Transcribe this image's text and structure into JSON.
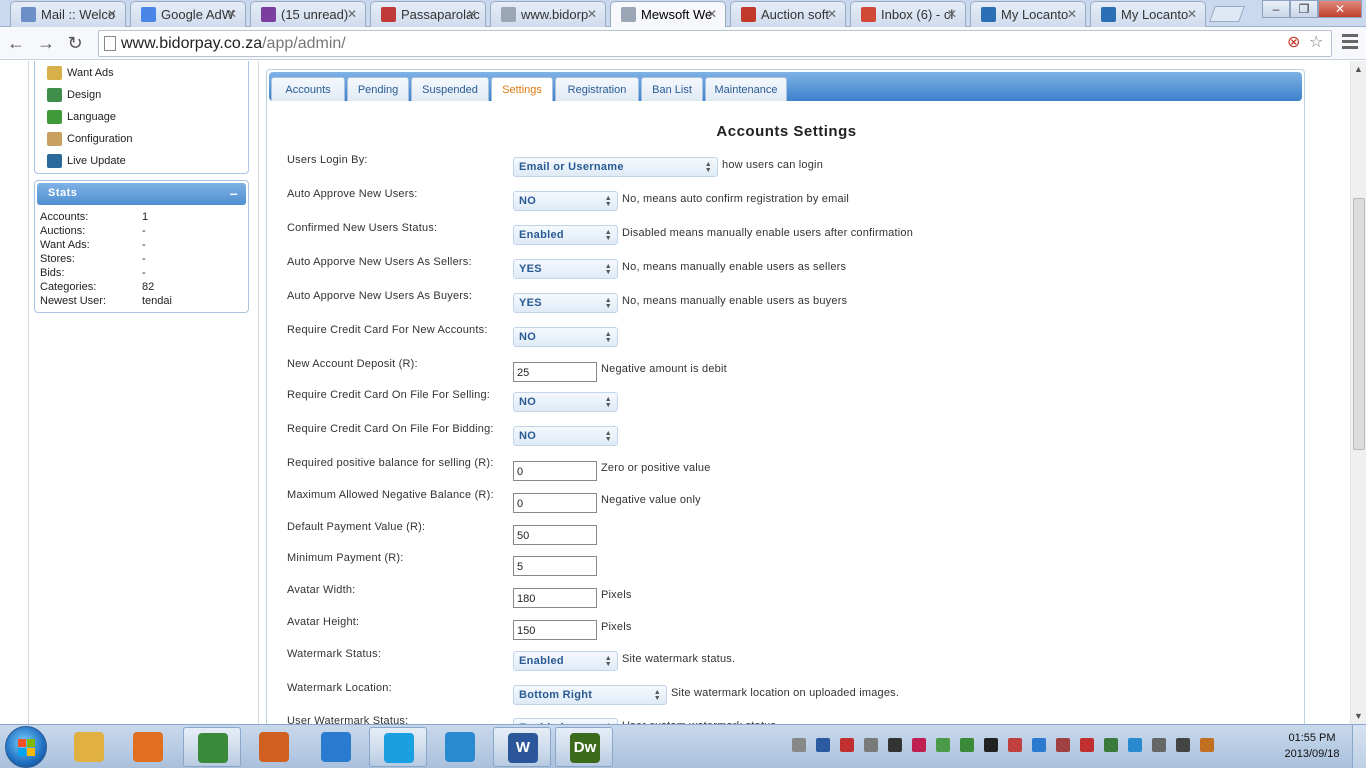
{
  "browser": {
    "tabs": [
      {
        "title": "Mail :: Welco",
        "icon": "mail-icon",
        "color": "#6d8fc7"
      },
      {
        "title": "Google AdW",
        "icon": "google-adwords-icon",
        "color": "#4a86e8"
      },
      {
        "title": "(15 unread)",
        "icon": "yahoo-mail-icon",
        "color": "#7b3fa0"
      },
      {
        "title": "Passaparolac",
        "icon": "passaparola-icon",
        "color": "#c03a3a"
      },
      {
        "title": "www.bidorp",
        "icon": "page-icon",
        "color": "#9aa5b5"
      },
      {
        "title": "Mewsoft We",
        "icon": "page-icon",
        "color": "#9aa5b5",
        "active": true
      },
      {
        "title": "Auction soft",
        "icon": "auction-software-icon",
        "color": "#c0392b"
      },
      {
        "title": "Inbox (6) - cl",
        "icon": "gmail-icon",
        "color": "#d14836"
      },
      {
        "title": "My Locanto",
        "icon": "locanto-icon",
        "color": "#2d6fb5"
      },
      {
        "title": "My Locanto",
        "icon": "locanto-icon",
        "color": "#2d6fb5"
      }
    ],
    "url_domain": "www.bidorpay.co.za",
    "url_path": "/app/admin/"
  },
  "sidebar": {
    "menu": [
      {
        "label": "Want Ads",
        "icon": "want-ads-icon",
        "color": "#d8b04a"
      },
      {
        "label": "Design",
        "icon": "design-icon",
        "color": "#3f8f4a"
      },
      {
        "label": "Language",
        "icon": "language-icon",
        "color": "#3f9a3a"
      },
      {
        "label": "Configuration",
        "icon": "configuration-icon",
        "color": "#c9a060"
      },
      {
        "label": "Live Update",
        "icon": "live-update-icon",
        "color": "#2a6a9a"
      }
    ],
    "stats": {
      "title": "Stats",
      "collapse": "–",
      "rows": [
        {
          "label": "Accounts:",
          "value": "1"
        },
        {
          "label": "Auctions:",
          "value": "-"
        },
        {
          "label": "Want Ads:",
          "value": "-"
        },
        {
          "label": "Stores:",
          "value": "-"
        },
        {
          "label": "Bids:",
          "value": "-"
        },
        {
          "label": "Categories:",
          "value": "82"
        },
        {
          "label": "Newest User:",
          "value": "tendai"
        }
      ]
    }
  },
  "admin_tabs": [
    "Accounts",
    "Pending",
    "Suspended",
    "Settings",
    "Registration",
    "Ban List",
    "Maintenance"
  ],
  "active_tab": "Settings",
  "page_title": "Accounts Settings",
  "fields": [
    {
      "label": "Users Login By:",
      "type": "select",
      "value": "Email or Username",
      "note": "how users can login"
    },
    {
      "label": "Auto Approve New Users:",
      "type": "select",
      "value": "NO",
      "note": "No, means auto confirm registration by email"
    },
    {
      "label": "Confirmed New Users Status:",
      "type": "select",
      "value": "Enabled",
      "note": "Disabled means manually enable users after confirmation"
    },
    {
      "label": "Auto Apporve New Users As Sellers:",
      "type": "select",
      "value": "YES",
      "note": "No, means manually enable users as sellers"
    },
    {
      "label": "Auto Apporve New Users As Buyers:",
      "type": "select",
      "value": "YES",
      "note": "No, means manually enable users as buyers"
    },
    {
      "label": "Require Credit Card For New Accounts:",
      "type": "select",
      "value": "NO",
      "note": ""
    },
    {
      "label": "New Account Deposit (R):",
      "type": "input",
      "value": "25",
      "note": "Negative amount is debit"
    },
    {
      "label": "Require Credit Card On File For Selling:",
      "type": "select",
      "value": "NO",
      "note": ""
    },
    {
      "label": "Require Credit Card On File For Bidding:",
      "type": "select",
      "value": "NO",
      "note": ""
    },
    {
      "label": "Required positive balance for selling (R):",
      "type": "input",
      "value": "0",
      "note": "Zero or positive value"
    },
    {
      "label": "Maximum Allowed Negative Balance (R):",
      "type": "input",
      "value": "0",
      "note": "Negative value only"
    },
    {
      "label": "Default Payment Value (R):",
      "type": "input",
      "value": "50",
      "note": ""
    },
    {
      "label": "Minimum Payment (R):",
      "type": "input",
      "value": "5",
      "note": ""
    },
    {
      "label": "Avatar Width:",
      "type": "input",
      "value": "180",
      "note": "Pixels"
    },
    {
      "label": "Avatar Height:",
      "type": "input",
      "value": "150",
      "note": "Pixels"
    },
    {
      "label": "Watermark Status:",
      "type": "select",
      "value": "Enabled",
      "note": "Site watermark status."
    },
    {
      "label": "Watermark Location:",
      "type": "select",
      "value": "Bottom Right",
      "note": "Site watermark location on uploaded images."
    },
    {
      "label": "User Watermark Status:",
      "type": "select",
      "value": "Enabled",
      "note": "User custom watermark status"
    }
  ],
  "taskbar": {
    "apps": [
      {
        "name": "file-explorer-icon",
        "color": "#e0b040",
        "open": false
      },
      {
        "name": "media-player-icon",
        "color": "#e07020",
        "open": false
      },
      {
        "name": "chrome-icon",
        "color": "#3a8a3a",
        "open": true
      },
      {
        "name": "installer-icon",
        "color": "#d06020",
        "open": false
      },
      {
        "name": "internet-explorer-icon",
        "color": "#2a7ad0",
        "open": false
      },
      {
        "name": "skype-icon",
        "color": "#1aa0e0",
        "open": true
      },
      {
        "name": "sync-app-icon",
        "color": "#2a8ad0",
        "open": false
      },
      {
        "name": "word-icon",
        "color": "#2b579a",
        "label": "W",
        "open": true
      },
      {
        "name": "dreamweaver-icon",
        "color": "#3a6a1a",
        "label": "Dw",
        "open": true
      }
    ],
    "time": "01:55 PM",
    "date": "2013/09/18"
  }
}
